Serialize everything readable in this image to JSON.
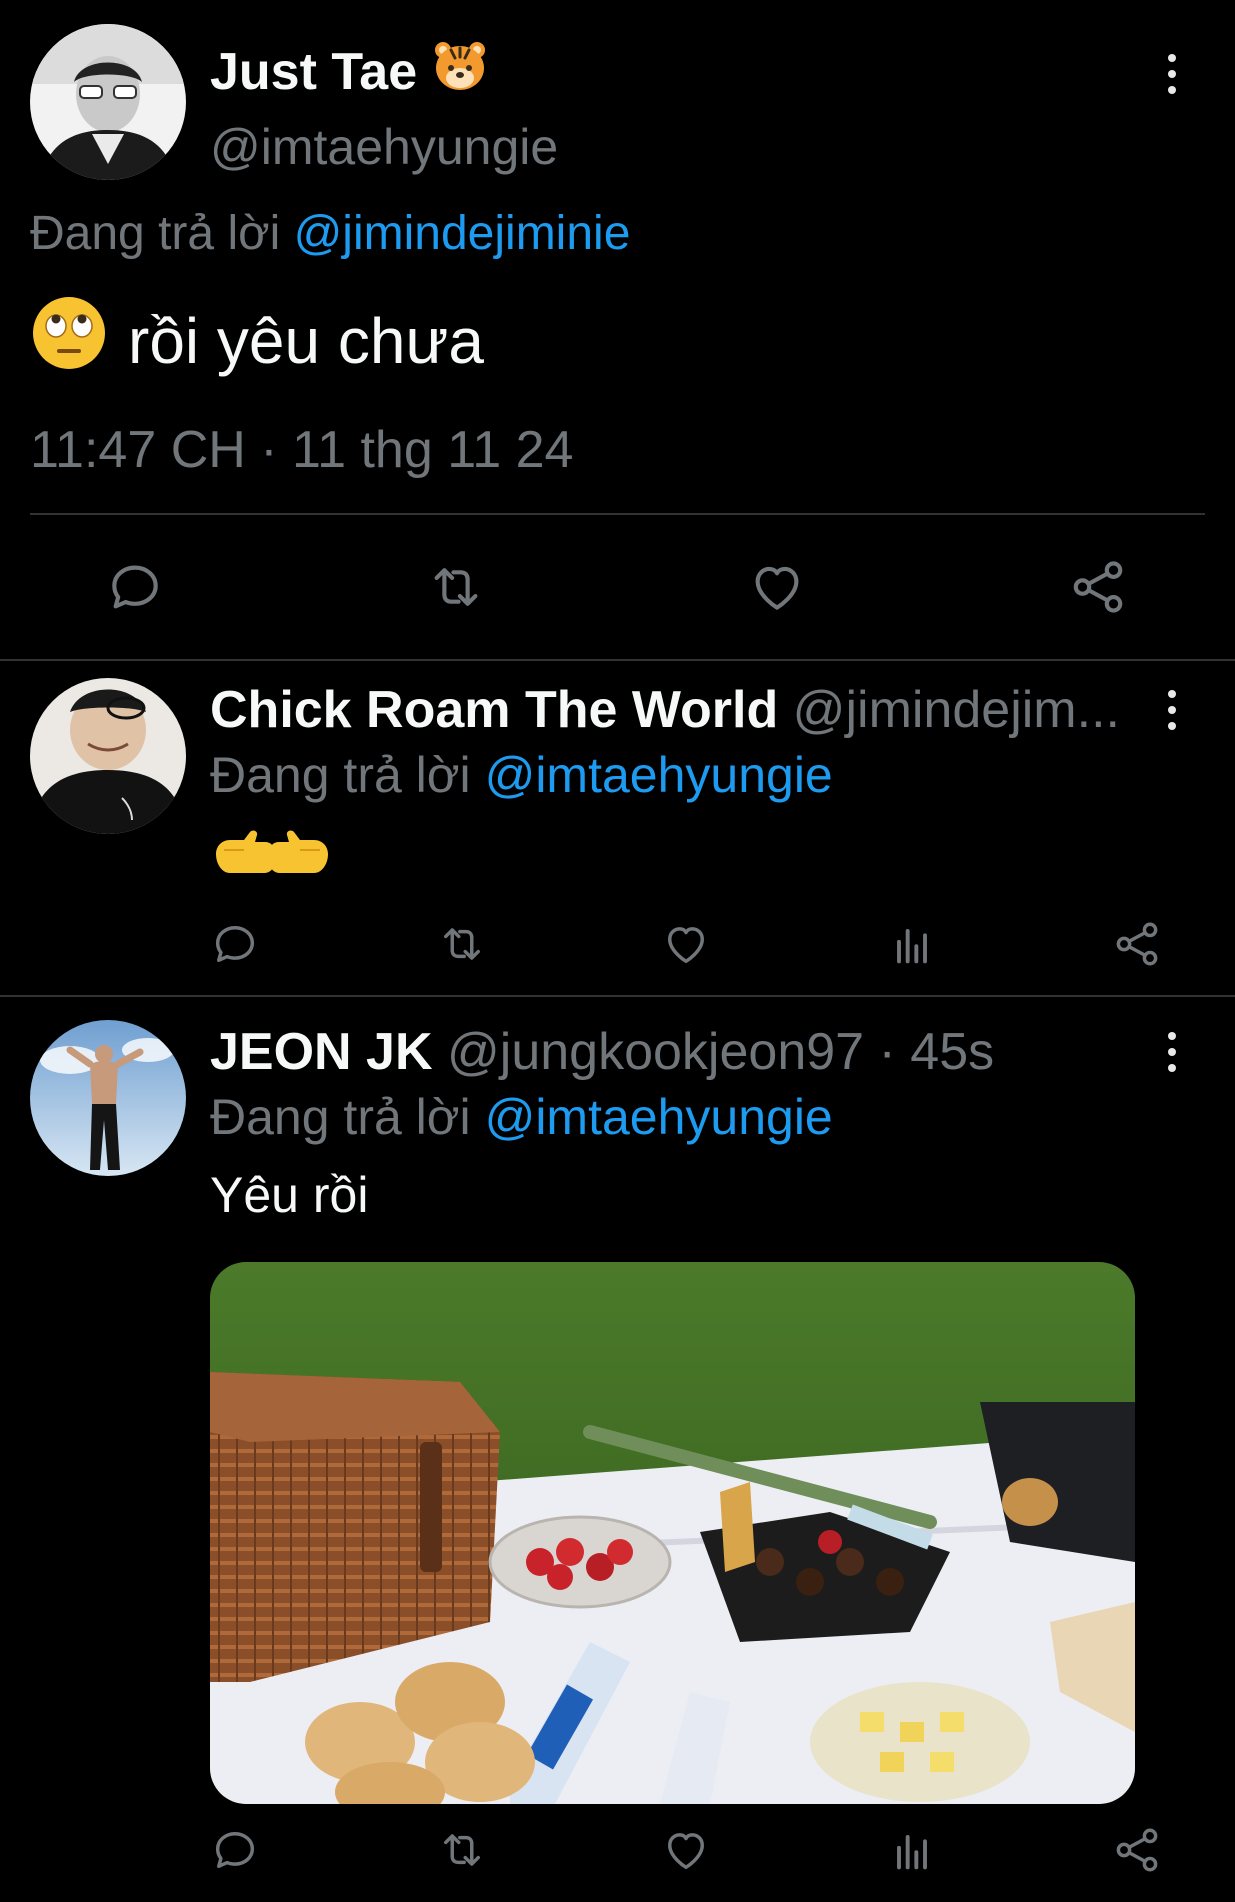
{
  "main_tweet": {
    "display_name": "Just Tae",
    "handle": "@imtaehyungie",
    "replying_prefix": "Đang trả lời ",
    "replying_to": "@jimindejiminie",
    "text": "rồi yêu chưa",
    "timestamp": "11:47 CH · 11 thg 11 24"
  },
  "replies": [
    {
      "display_name": "Chick Roam The World",
      "handle": "@jimindejim...",
      "replying_prefix": "Đang trả lời ",
      "replying_to": "@imtaehyungie"
    },
    {
      "display_name": "JEON JK",
      "handle": "@jungkookjeon97 · 45s",
      "replying_prefix": "Đang trả lời ",
      "replying_to": "@imtaehyungie",
      "text": "Yêu rồi"
    }
  ],
  "icons": {
    "reply": "reply-icon",
    "retweet": "retweet-icon",
    "like": "like-icon",
    "views": "views-icon",
    "share": "share-icon",
    "more": "more-icon"
  },
  "colors": {
    "background": "#000000",
    "text": "#e7e9ea",
    "muted": "#71767b",
    "link": "#1d9bf0",
    "divider": "#2f3336"
  }
}
